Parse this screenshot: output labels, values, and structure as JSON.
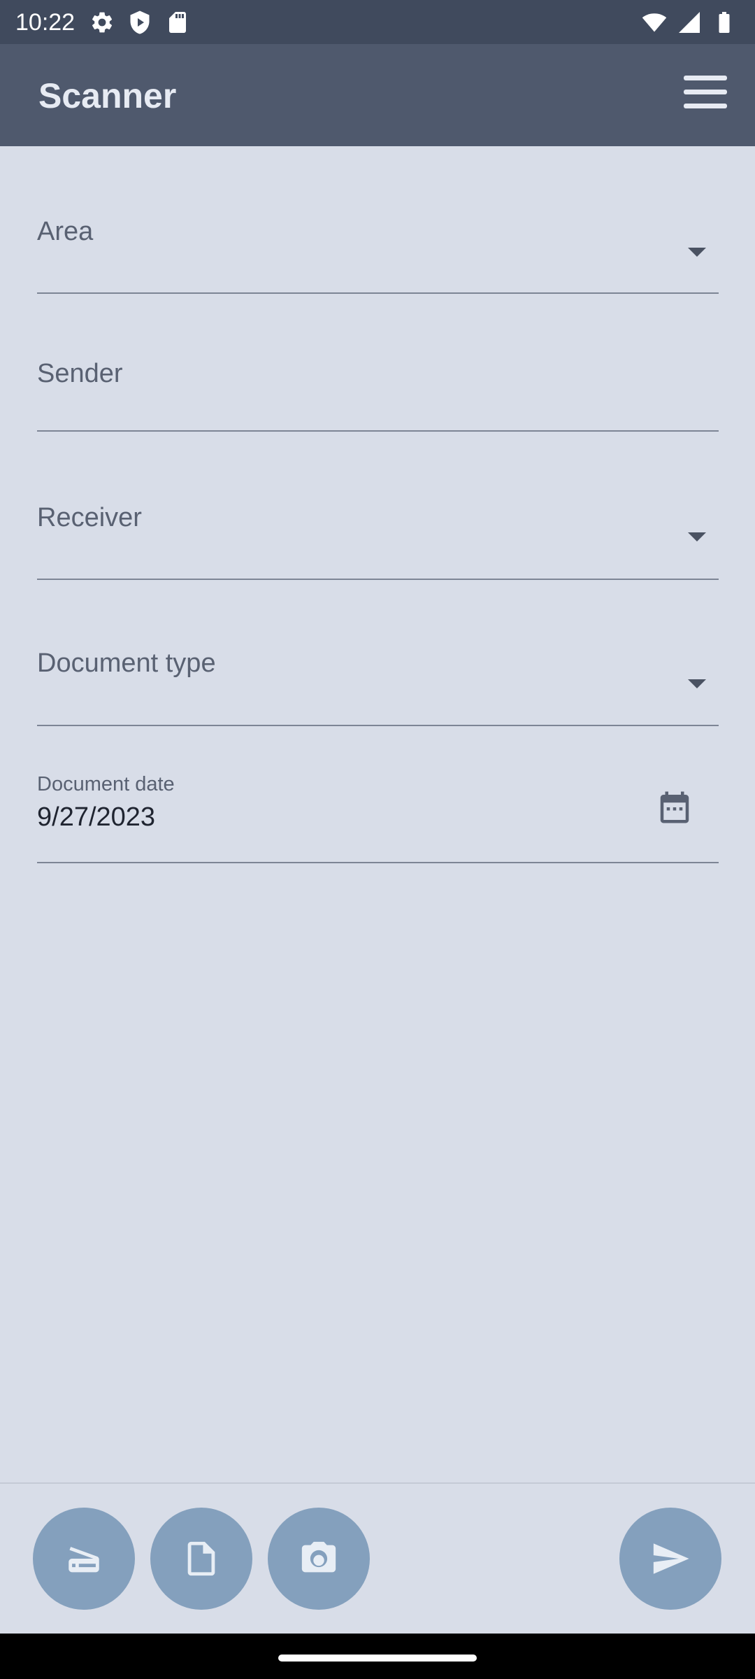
{
  "status_bar": {
    "time": "10:22",
    "left_icons": [
      "gear-icon",
      "shield-icon",
      "sd-card-icon"
    ],
    "right_icons": [
      "wifi-icon",
      "signal-icon",
      "battery-icon"
    ]
  },
  "app_bar": {
    "title": "Scanner",
    "menu_icon": "hamburger-menu-icon"
  },
  "form": {
    "area": {
      "label": "Area",
      "icon": "dropdown-caret-icon"
    },
    "sender": {
      "label": "Sender"
    },
    "receiver": {
      "label": "Receiver",
      "icon": "dropdown-caret-icon"
    },
    "document_type": {
      "label": "Document type",
      "icon": "dropdown-caret-icon"
    },
    "document_date": {
      "label": "Document date",
      "value": "9/27/2023",
      "icon": "calendar-icon"
    }
  },
  "bottom_actions": {
    "buttons": [
      "scanner-icon",
      "document-icon",
      "camera-icon",
      "send-icon"
    ],
    "color": "#84a0bd"
  },
  "colors": {
    "background": "#d8dde8",
    "app_bar": "#4f596d",
    "status_bar": "#404a5d"
  }
}
